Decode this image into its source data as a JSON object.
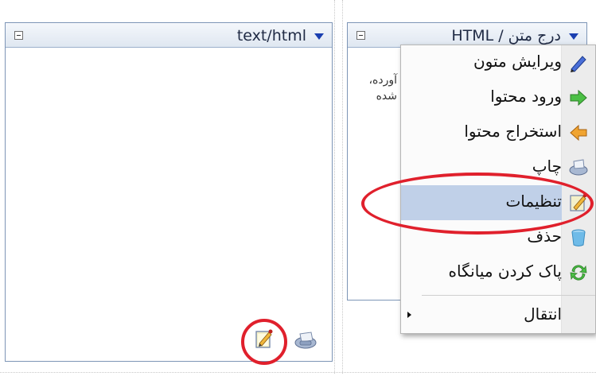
{
  "left_module": {
    "title": "text/html",
    "collapse_icon": "minus-box-icon",
    "menu_icon": "dropdown-arrow-icon",
    "toolbar_icons": [
      "edit-icon",
      "print-icon"
    ]
  },
  "right_module": {
    "title": "HTML / درج متن",
    "content_lines": [
      "آورده،",
      "شده"
    ]
  },
  "context_menu": {
    "items": [
      {
        "label": "ویرایش متون",
        "icon": "pencil-icon"
      },
      {
        "label": "ورود محتوا",
        "icon": "import-arrow-icon"
      },
      {
        "label": "استخراج محتوا",
        "icon": "export-arrow-icon"
      },
      {
        "label": "چاپ",
        "icon": "print-icon"
      },
      {
        "label": "تنظیمات",
        "icon": "settings-edit-icon",
        "selected": true
      },
      {
        "label": "حذف",
        "icon": "trash-icon"
      },
      {
        "label": "پاک کردن میانگاه",
        "icon": "refresh-icon"
      },
      {
        "label": "انتقال",
        "icon": "none",
        "has_submenu": true
      }
    ]
  },
  "highlight_color": "#e0202c"
}
